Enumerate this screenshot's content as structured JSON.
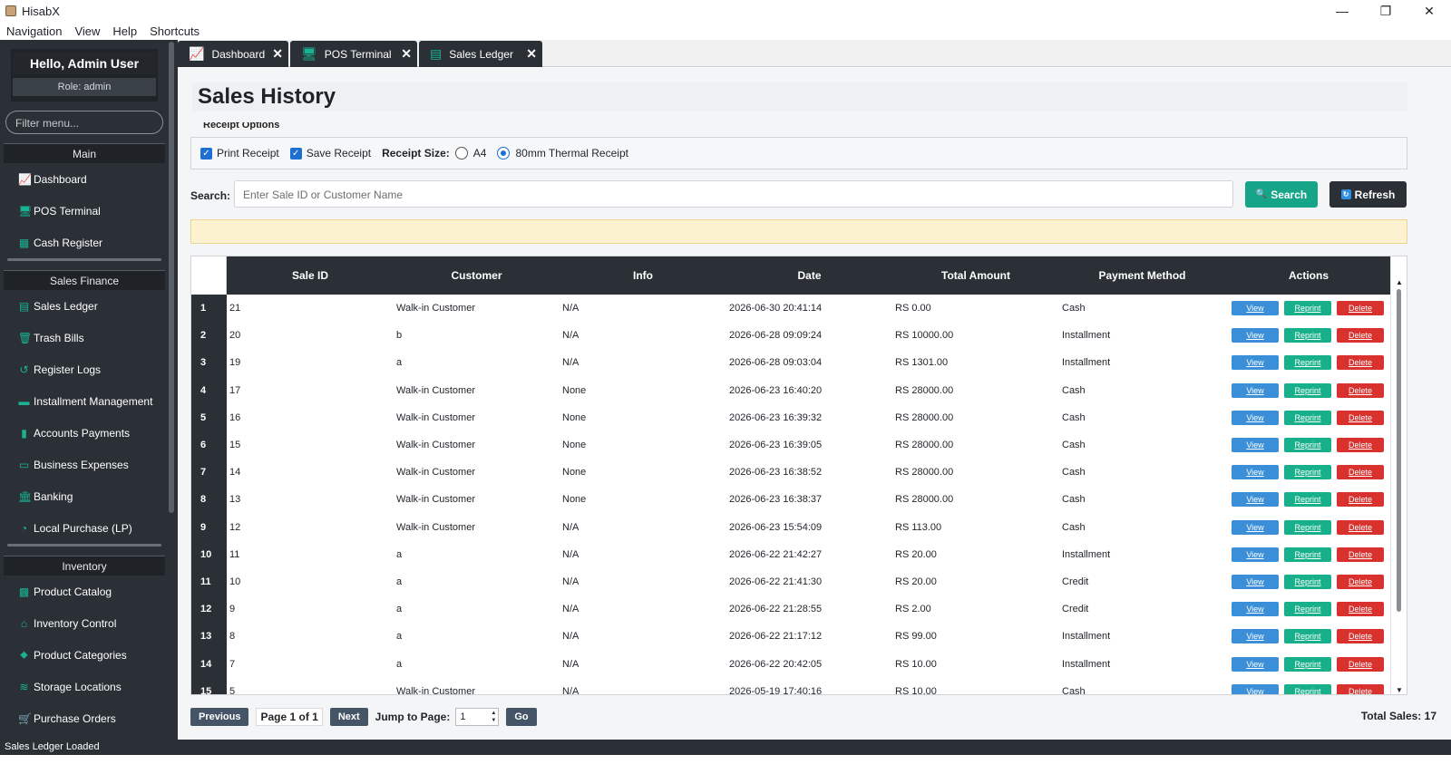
{
  "window": {
    "title": "HisabX",
    "minimize": "—",
    "restore": "❐",
    "close": "✕"
  },
  "menubar": [
    "Navigation",
    "View",
    "Help",
    "Shortcuts"
  ],
  "sidebar": {
    "greeting": "Hello, Admin User",
    "role": "Role: admin",
    "filter_placeholder": "Filter menu...",
    "sections": [
      {
        "header": "Main",
        "items": [
          {
            "label": "Dashboard",
            "icon": "chart-icon"
          },
          {
            "label": "POS Terminal",
            "icon": "monitor-icon"
          },
          {
            "label": "Cash Register",
            "icon": "register-icon"
          }
        ]
      },
      {
        "header": "Sales  Finance",
        "items": [
          {
            "label": "Sales Ledger",
            "icon": "ledger-icon"
          },
          {
            "label": "Trash Bills",
            "icon": "trash-icon"
          },
          {
            "label": "Register Logs",
            "icon": "history-icon"
          },
          {
            "label": "Installment Management",
            "icon": "card-icon"
          },
          {
            "label": "Accounts  Payments",
            "icon": "invoice-icon"
          },
          {
            "label": "Business Expenses",
            "icon": "money-icon"
          },
          {
            "label": "Banking",
            "icon": "bank-icon"
          },
          {
            "label": "Local Purchase (LP)",
            "icon": "pie-icon"
          }
        ]
      },
      {
        "header": "Inventory",
        "items": [
          {
            "label": "Product Catalog",
            "icon": "boxes-icon"
          },
          {
            "label": "Inventory Control",
            "icon": "warehouse-icon"
          },
          {
            "label": "Product Categories",
            "icon": "tag-icon"
          },
          {
            "label": "Storage Locations",
            "icon": "layers-icon"
          },
          {
            "label": "Purchase Orders",
            "icon": "cart-icon"
          }
        ]
      }
    ]
  },
  "tabs": [
    {
      "label": "Dashboard",
      "icon": "chart-icon"
    },
    {
      "label": "POS Terminal",
      "icon": "monitor-icon"
    },
    {
      "label": "Sales Ledger",
      "icon": "ledger-icon"
    }
  ],
  "page": {
    "title": "Sales History",
    "receipt_legend": "Receipt Options",
    "print_receipt": "Print Receipt",
    "save_receipt": "Save Receipt",
    "receipt_size_label": "Receipt Size:",
    "size_a4": "A4",
    "size_thermal": "80mm Thermal Receipt",
    "search_label": "Search:",
    "search_placeholder": "Enter Sale ID or Customer Name",
    "search_button": "Search",
    "refresh_button": "Refresh"
  },
  "table": {
    "columns": [
      "Sale ID",
      "Customer",
      "Info",
      "Date",
      "Total Amount",
      "Payment Method",
      "Actions"
    ],
    "action_labels": {
      "view": "View",
      "reprint": "Reprint",
      "delete": "Delete"
    },
    "rows": [
      {
        "num": "1",
        "sale_id": "21",
        "customer": "Walk-in Customer",
        "info": "N/A",
        "date": "2026-06-30 20:41:14",
        "total": "RS 0.00",
        "method": "Cash"
      },
      {
        "num": "2",
        "sale_id": "20",
        "customer": "b",
        "info": "N/A",
        "date": "2026-06-28 09:09:24",
        "total": "RS 10000.00",
        "method": "Installment"
      },
      {
        "num": "3",
        "sale_id": "19",
        "customer": "a",
        "info": "N/A",
        "date": "2026-06-28 09:03:04",
        "total": "RS 1301.00",
        "method": "Installment"
      },
      {
        "num": "4",
        "sale_id": "17",
        "customer": "Walk-in Customer",
        "info": "None",
        "date": "2026-06-23 16:40:20",
        "total": "RS 28000.00",
        "method": "Cash"
      },
      {
        "num": "5",
        "sale_id": "16",
        "customer": "Walk-in Customer",
        "info": "None",
        "date": "2026-06-23 16:39:32",
        "total": "RS 28000.00",
        "method": "Cash"
      },
      {
        "num": "6",
        "sale_id": "15",
        "customer": "Walk-in Customer",
        "info": "None",
        "date": "2026-06-23 16:39:05",
        "total": "RS 28000.00",
        "method": "Cash"
      },
      {
        "num": "7",
        "sale_id": "14",
        "customer": "Walk-in Customer",
        "info": "None",
        "date": "2026-06-23 16:38:52",
        "total": "RS 28000.00",
        "method": "Cash"
      },
      {
        "num": "8",
        "sale_id": "13",
        "customer": "Walk-in Customer",
        "info": "None",
        "date": "2026-06-23 16:38:37",
        "total": "RS 28000.00",
        "method": "Cash"
      },
      {
        "num": "9",
        "sale_id": "12",
        "customer": "Walk-in Customer",
        "info": "N/A",
        "date": "2026-06-23 15:54:09",
        "total": "RS 113.00",
        "method": "Cash"
      },
      {
        "num": "10",
        "sale_id": "11",
        "customer": "a",
        "info": "N/A",
        "date": "2026-06-22 21:42:27",
        "total": "RS 20.00",
        "method": "Installment"
      },
      {
        "num": "11",
        "sale_id": "10",
        "customer": "a",
        "info": "N/A",
        "date": "2026-06-22 21:41:30",
        "total": "RS 20.00",
        "method": "Credit"
      },
      {
        "num": "12",
        "sale_id": "9",
        "customer": "a",
        "info": "N/A",
        "date": "2026-06-22 21:28:55",
        "total": "RS 2.00",
        "method": "Credit"
      },
      {
        "num": "13",
        "sale_id": "8",
        "customer": "a",
        "info": "N/A",
        "date": "2026-06-22 21:17:12",
        "total": "RS 99.00",
        "method": "Installment"
      },
      {
        "num": "14",
        "sale_id": "7",
        "customer": "a",
        "info": "N/A",
        "date": "2026-06-22 20:42:05",
        "total": "RS 10.00",
        "method": "Installment"
      },
      {
        "num": "15",
        "sale_id": "5",
        "customer": "Walk-in Customer",
        "info": "N/A",
        "date": "2026-05-19 17:40:16",
        "total": "RS 10.00",
        "method": "Cash"
      }
    ]
  },
  "pager": {
    "previous": "Previous",
    "page_info": "Page 1 of 1",
    "next": "Next",
    "jump_label": "Jump to Page:",
    "jump_value": "1",
    "go": "Go",
    "total_sales": "Total Sales: 17"
  },
  "status": {
    "text": "Sales Ledger Loaded"
  },
  "colors": {
    "accent": "#17a589",
    "dark": "#2b3036",
    "view": "#3a8fd8",
    "delete": "#d9322e"
  }
}
